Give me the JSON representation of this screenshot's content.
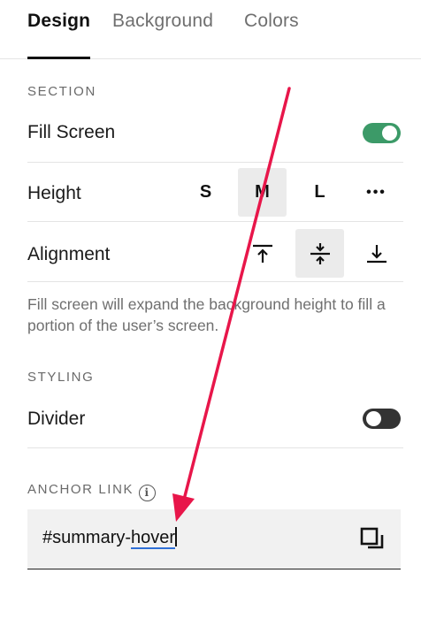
{
  "tabs": [
    {
      "label": "Design",
      "active": true
    },
    {
      "label": "Background",
      "active": false
    },
    {
      "label": "Colors",
      "active": false
    }
  ],
  "section": {
    "heading": "SECTION",
    "fill_screen": {
      "label": "Fill Screen",
      "enabled": true
    },
    "height": {
      "label": "Height",
      "options": [
        "S",
        "M",
        "L"
      ],
      "selected": "M",
      "more_label": "•••"
    },
    "alignment": {
      "label": "Alignment",
      "options": [
        "top",
        "center",
        "bottom"
      ],
      "selected": "center"
    },
    "help_text": "Fill screen will expand the background height to fill a portion of the user’s screen."
  },
  "styling": {
    "heading": "STYLING",
    "divider": {
      "label": "Divider",
      "enabled": false
    }
  },
  "anchor": {
    "heading": "ANCHOR LINK",
    "value_prefix": "#summary-",
    "value_selected": "hover"
  },
  "colors": {
    "toggle_on": "#3c9a68",
    "toggle_off": "#333333",
    "annotation_arrow": "#e8164a",
    "selection_underline": "#2f6fd6"
  }
}
